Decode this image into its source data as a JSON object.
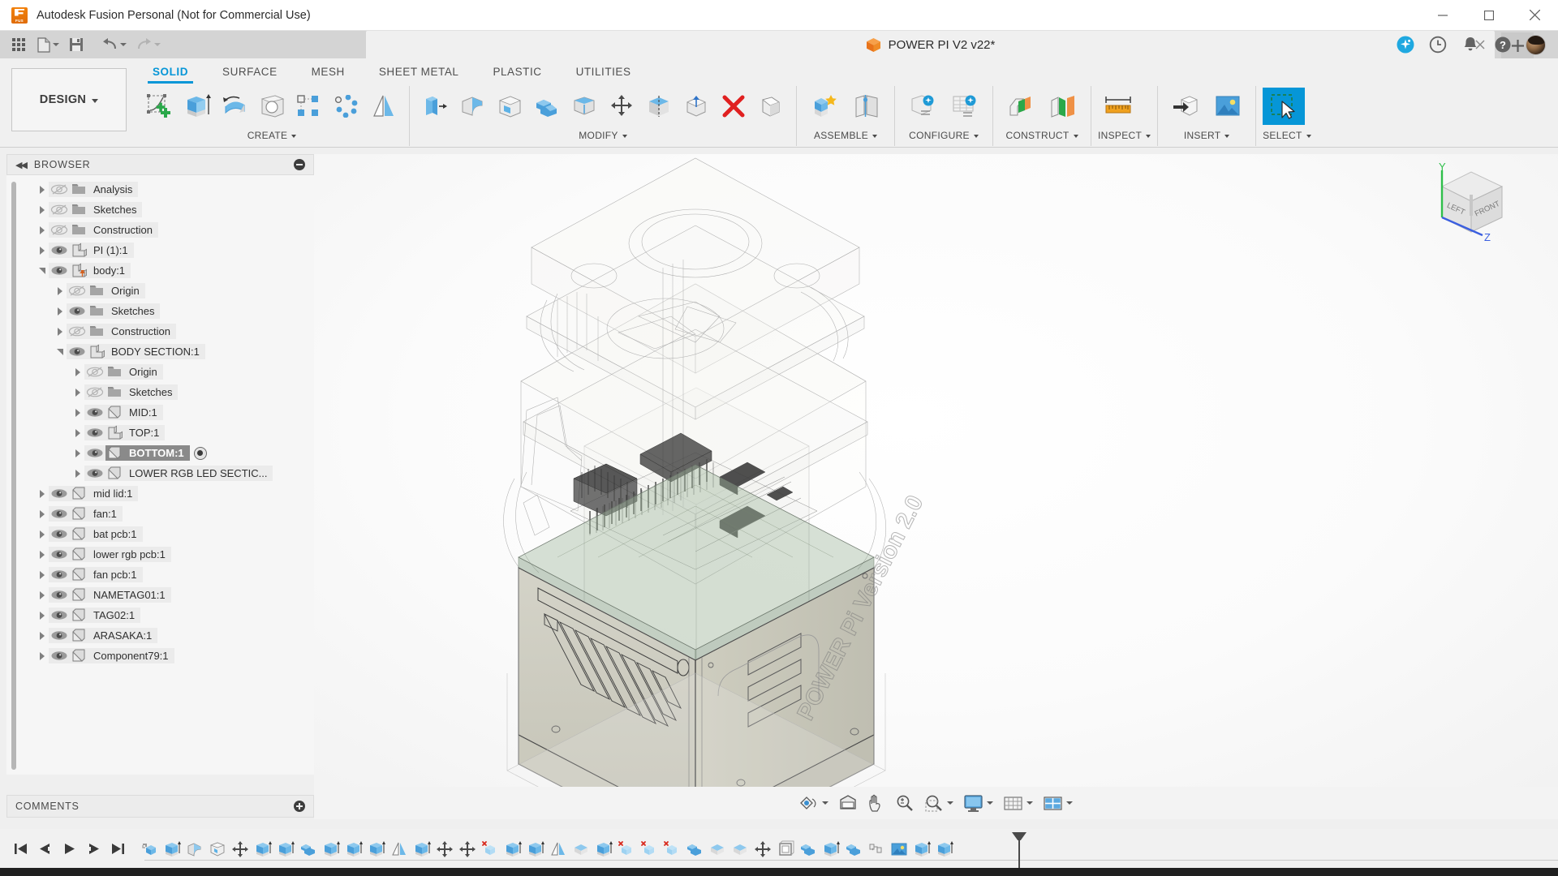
{
  "window": {
    "title": "Autodesk Fusion Personal (Not for Commercial Use)",
    "app_icon": "fusion-logo-icon",
    "minimize": "minimize-icon",
    "maximize": "maximize-icon",
    "close": "close-icon"
  },
  "quick_access": {
    "buttons": [
      {
        "name": "app-grid-button",
        "icon": "grid-icon",
        "label": ""
      },
      {
        "name": "new-document-button",
        "icon": "file-icon",
        "label": ""
      },
      {
        "name": "save-button",
        "icon": "save-icon",
        "label": ""
      },
      {
        "name": "undo-button",
        "icon": "undo-arrow-icon",
        "label": ""
      },
      {
        "name": "redo-button",
        "icon": "redo-arrow-icon",
        "label": ""
      }
    ]
  },
  "document_tab": {
    "label": "POWER PI V2 v22*",
    "icon": "orange-cube-icon",
    "modified": true,
    "close_icon": "close-icon",
    "add_tab_icon": "plus-icon"
  },
  "tab_right_icons": [
    {
      "name": "fusion-assistant-icon",
      "label": "Assistant",
      "color": "#1fa8e0"
    },
    {
      "name": "job-status-clock-icon",
      "label": "Job Status"
    },
    {
      "name": "notifications-bell-icon",
      "label": "Notifications"
    },
    {
      "name": "help-question-icon",
      "label": "Help"
    },
    {
      "name": "user-avatar",
      "label": "Account"
    }
  ],
  "workspace": {
    "selector_label": "DESIGN",
    "tabs": [
      {
        "label": "SOLID",
        "active": true
      },
      {
        "label": "SURFACE",
        "active": false
      },
      {
        "label": "MESH",
        "active": false
      },
      {
        "label": "SHEET METAL",
        "active": false
      },
      {
        "label": "PLASTIC",
        "active": false
      },
      {
        "label": "UTILITIES",
        "active": false
      }
    ]
  },
  "ribbon_panels": [
    {
      "label": "CREATE",
      "has_dropdown": true,
      "buttons": [
        {
          "name": "create-sketch-button",
          "icon": "sketch-plus-icon"
        },
        {
          "name": "extrude-button",
          "icon": "extrude-icon"
        },
        {
          "name": "revolve-button",
          "icon": "revolve-icon"
        },
        {
          "name": "hole-button",
          "icon": "hole-icon"
        },
        {
          "name": "rectangular-pattern-button",
          "icon": "rect-pattern-icon"
        },
        {
          "name": "circular-pattern-button",
          "icon": "circ-pattern-icon"
        },
        {
          "name": "mirror-button",
          "icon": "mirror-icon"
        }
      ]
    },
    {
      "label": "MODIFY",
      "has_dropdown": true,
      "buttons": [
        {
          "name": "press-pull-button",
          "icon": "press-pull-icon"
        },
        {
          "name": "fillet-button",
          "icon": "fillet-icon"
        },
        {
          "name": "shell-button",
          "icon": "shell-icon"
        },
        {
          "name": "combine-button",
          "icon": "combine-icon"
        },
        {
          "name": "offset-face-button",
          "icon": "offset-face-icon"
        },
        {
          "name": "move-copy-button",
          "icon": "move-copy-icon"
        },
        {
          "name": "split-face-button",
          "icon": "split-face-icon"
        },
        {
          "name": "align-button",
          "icon": "align-icon"
        },
        {
          "name": "delete-button",
          "icon": "red-x-delete-icon"
        },
        {
          "name": "draft-button",
          "icon": "draft-icon"
        }
      ]
    },
    {
      "label": "ASSEMBLE",
      "has_dropdown": true,
      "buttons": [
        {
          "name": "new-component-button",
          "icon": "new-component-icon"
        },
        {
          "name": "joint-button",
          "icon": "joint-icon"
        }
      ]
    },
    {
      "label": "CONFIGURE",
      "has_dropdown": true,
      "buttons": [
        {
          "name": "create-configuration-button",
          "icon": "configure-part-icon"
        },
        {
          "name": "configuration-table-button",
          "icon": "configure-table-icon"
        }
      ]
    },
    {
      "label": "CONSTRUCT",
      "has_dropdown": true,
      "buttons": [
        {
          "name": "offset-plane-button",
          "icon": "offset-plane-icon"
        },
        {
          "name": "plane-through-edge-button",
          "icon": "angle-plane-icon"
        }
      ]
    },
    {
      "label": "INSPECT",
      "has_dropdown": true,
      "buttons": [
        {
          "name": "measure-button",
          "icon": "measure-ruler-icon"
        }
      ]
    },
    {
      "label": "INSERT",
      "has_dropdown": true,
      "buttons": [
        {
          "name": "insert-derive-button",
          "icon": "insert-derive-icon"
        },
        {
          "name": "canvas-image-button",
          "icon": "canvas-image-icon"
        }
      ]
    },
    {
      "label": "SELECT",
      "has_dropdown": true,
      "buttons": [
        {
          "name": "select-tool-button",
          "icon": "select-arrow-icon",
          "selected": true
        }
      ]
    }
  ],
  "browser": {
    "title": "BROWSER",
    "collapse_icon": "collapse-left-icon",
    "toggle_icon": "minus-circle-icon",
    "tree": [
      {
        "label": "Analysis",
        "depth": 0,
        "arrow": "collapsed",
        "eye": "hidden",
        "icon": "folder-icon"
      },
      {
        "label": "Sketches",
        "depth": 0,
        "arrow": "collapsed",
        "eye": "hidden",
        "icon": "folder-icon"
      },
      {
        "label": "Construction",
        "depth": 0,
        "arrow": "collapsed",
        "eye": "hidden",
        "icon": "folder-icon"
      },
      {
        "label": "PI (1):1",
        "depth": 0,
        "arrow": "collapsed",
        "eye": "visible",
        "icon": "component-icon"
      },
      {
        "label": "body:1",
        "depth": 0,
        "arrow": "expanded",
        "eye": "visible",
        "icon": "component-pin-icon"
      },
      {
        "label": "Origin",
        "depth": 1,
        "arrow": "collapsed",
        "eye": "hidden",
        "icon": "folder-icon"
      },
      {
        "label": "Sketches",
        "depth": 1,
        "arrow": "collapsed",
        "eye": "visible",
        "icon": "folder-icon"
      },
      {
        "label": "Construction",
        "depth": 1,
        "arrow": "collapsed",
        "eye": "hidden",
        "icon": "folder-icon"
      },
      {
        "label": "BODY SECTION:1",
        "depth": 1,
        "arrow": "expanded",
        "eye": "visible",
        "icon": "component-icon"
      },
      {
        "label": "Origin",
        "depth": 2,
        "arrow": "collapsed",
        "eye": "hidden",
        "icon": "folder-icon"
      },
      {
        "label": "Sketches",
        "depth": 2,
        "arrow": "collapsed",
        "eye": "hidden",
        "icon": "folder-icon"
      },
      {
        "label": "MID:1",
        "depth": 2,
        "arrow": "collapsed",
        "eye": "visible",
        "icon": "body-icon"
      },
      {
        "label": "TOP:1",
        "depth": 2,
        "arrow": "collapsed",
        "eye": "visible",
        "icon": "component-icon"
      },
      {
        "label": "BOTTOM:1",
        "depth": 2,
        "arrow": "collapsed",
        "eye": "visible",
        "icon": "body-icon",
        "selected": true,
        "radio": true
      },
      {
        "label": "LOWER RGB LED SECTIC...",
        "depth": 2,
        "arrow": "collapsed",
        "eye": "visible",
        "icon": "body-icon"
      },
      {
        "label": "mid lid:1",
        "depth": 0,
        "arrow": "collapsed",
        "eye": "visible",
        "icon": "body-icon"
      },
      {
        "label": "fan:1",
        "depth": 0,
        "arrow": "collapsed",
        "eye": "visible",
        "icon": "body-icon"
      },
      {
        "label": "bat pcb:1",
        "depth": 0,
        "arrow": "collapsed",
        "eye": "visible",
        "icon": "body-icon"
      },
      {
        "label": "lower rgb pcb:1",
        "depth": 0,
        "arrow": "collapsed",
        "eye": "visible",
        "icon": "body-icon"
      },
      {
        "label": "fan pcb:1",
        "depth": 0,
        "arrow": "collapsed",
        "eye": "visible",
        "icon": "body-icon"
      },
      {
        "label": "NAMETAG01:1",
        "depth": 0,
        "arrow": "collapsed",
        "eye": "visible",
        "icon": "body-icon"
      },
      {
        "label": "TAG02:1",
        "depth": 0,
        "arrow": "collapsed",
        "eye": "visible",
        "icon": "body-icon"
      },
      {
        "label": "ARASAKA:1",
        "depth": 0,
        "arrow": "collapsed",
        "eye": "visible",
        "icon": "body-icon"
      },
      {
        "label": "Component79:1",
        "depth": 0,
        "arrow": "collapsed",
        "eye": "visible",
        "icon": "body-icon"
      }
    ]
  },
  "comments": {
    "title": "COMMENTS",
    "add_icon": "plus-circle-icon"
  },
  "canvas": {
    "model_name": "POWER PI V2",
    "embossed_text": "POWER Pi Version 2.0",
    "viewcube": {
      "face_left": "LEFT",
      "face_front": "FRONT",
      "axis_y": "Y",
      "axis_z": "Z",
      "axis_y_color": "#2fbf4a",
      "axis_z_color": "#3b5fe0"
    }
  },
  "view_toolbar": [
    {
      "name": "orbit-button",
      "icon": "orbit-icon",
      "caret": true
    },
    {
      "name": "display-settings-button",
      "icon": "display-box-icon",
      "caret": false
    },
    {
      "name": "pan-button",
      "icon": "pan-hand-icon",
      "caret": false
    },
    {
      "name": "zoom-button",
      "icon": "zoom-magnifier-icon",
      "caret": false
    },
    {
      "name": "zoom-window-button",
      "icon": "zoom-window-icon",
      "caret": true
    },
    {
      "name": "display-mode-button",
      "icon": "monitor-icon",
      "caret": true
    },
    {
      "name": "grid-snaps-button",
      "icon": "grid-snap-icon",
      "caret": true
    },
    {
      "name": "viewports-button",
      "icon": "viewport-layout-icon",
      "caret": true
    }
  ],
  "timeline": {
    "playback": [
      {
        "name": "timeline-go-start-button",
        "icon": "skip-start-icon"
      },
      {
        "name": "timeline-step-back-button",
        "icon": "step-back-icon"
      },
      {
        "name": "timeline-play-button",
        "icon": "play-icon"
      },
      {
        "name": "timeline-step-forward-button",
        "icon": "step-forward-icon"
      },
      {
        "name": "timeline-go-end-button",
        "icon": "skip-end-icon"
      }
    ],
    "features": [
      {
        "icon": "new-component-icon"
      },
      {
        "icon": "extrude-icon"
      },
      {
        "icon": "fillet-icon"
      },
      {
        "icon": "shell-icon"
      },
      {
        "icon": "move-copy-icon"
      },
      {
        "icon": "extrude-icon"
      },
      {
        "icon": "extrude-icon"
      },
      {
        "icon": "combine-icon"
      },
      {
        "icon": "extrude-icon"
      },
      {
        "icon": "extrude-icon"
      },
      {
        "icon": "extrude-icon"
      },
      {
        "icon": "mirror-icon"
      },
      {
        "icon": "extrude-icon"
      },
      {
        "icon": "move-copy-icon"
      },
      {
        "icon": "move-copy-icon"
      },
      {
        "icon": "delete-body-icon"
      },
      {
        "icon": "extrude-icon"
      },
      {
        "icon": "extrude-icon"
      },
      {
        "icon": "mirror-icon"
      },
      {
        "icon": "split-body-icon"
      },
      {
        "icon": "extrude-icon"
      },
      {
        "icon": "delete-body-icon"
      },
      {
        "icon": "delete-body-icon"
      },
      {
        "icon": "delete-body-icon"
      },
      {
        "icon": "combine-icon"
      },
      {
        "icon": "split-body-icon"
      },
      {
        "icon": "split-body-icon"
      },
      {
        "icon": "move-copy-icon"
      },
      {
        "icon": "shell-box-icon"
      },
      {
        "icon": "combine-icon"
      },
      {
        "icon": "extrude-icon"
      },
      {
        "icon": "combine-icon"
      },
      {
        "icon": "joint-icon"
      },
      {
        "icon": "canvas-image-icon"
      },
      {
        "icon": "extrude-icon"
      },
      {
        "icon": "extrude-icon"
      }
    ],
    "marker_position": "end"
  }
}
